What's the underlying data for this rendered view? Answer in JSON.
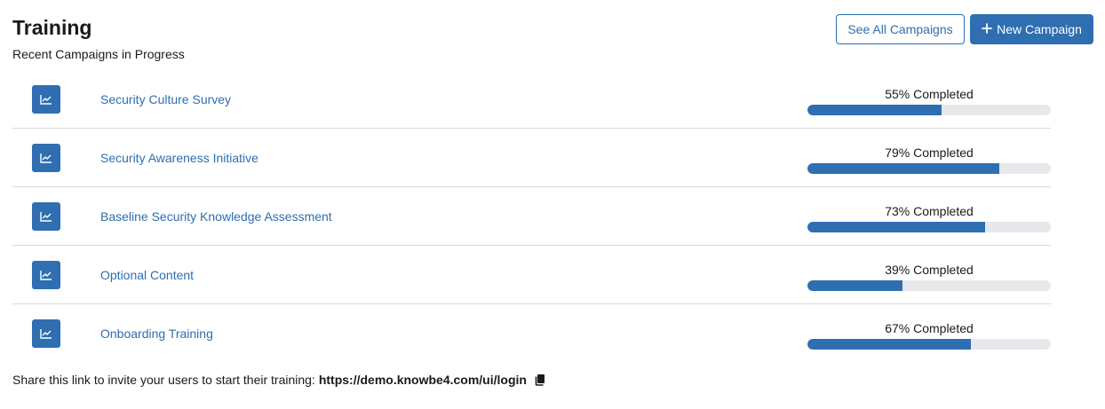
{
  "header": {
    "title": "Training",
    "subtitle": "Recent Campaigns in Progress"
  },
  "actions": {
    "see_all_label": "See All Campaigns",
    "new_campaign_label": "New Campaign",
    "new_campaign_icon": "plus-icon"
  },
  "colors": {
    "accent": "#2f6eb0",
    "track": "#e6e8eb",
    "divider": "#d9d9d9"
  },
  "campaigns": [
    {
      "name": "Security Culture Survey",
      "percent": 55,
      "status": "55% Completed",
      "icon": "line-chart-icon"
    },
    {
      "name": "Security Awareness Initiative",
      "percent": 79,
      "status": "79% Completed",
      "icon": "line-chart-icon"
    },
    {
      "name": "Baseline Security Knowledge Assessment",
      "percent": 73,
      "status": "73% Completed",
      "icon": "line-chart-icon"
    },
    {
      "name": "Optional Content",
      "percent": 39,
      "status": "39% Completed",
      "icon": "line-chart-icon"
    },
    {
      "name": "Onboarding Training",
      "percent": 67,
      "status": "67% Completed",
      "icon": "line-chart-icon"
    }
  ],
  "share": {
    "text": "Share this link to invite your users to start their training:",
    "url": "https://demo.knowbe4.com/ui/login",
    "icon": "copy-icon"
  }
}
